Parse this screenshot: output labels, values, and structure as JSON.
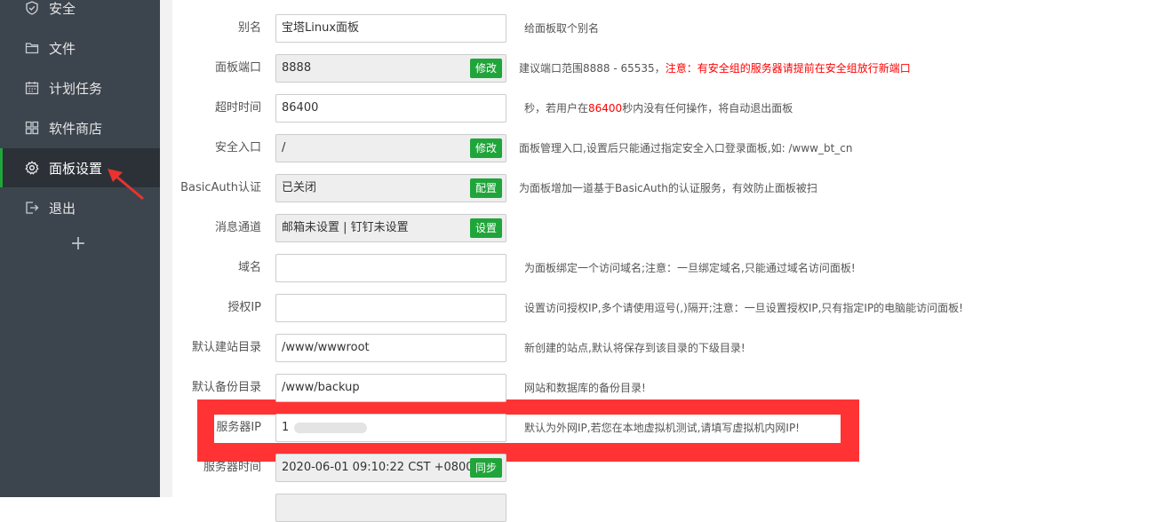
{
  "sidebar": {
    "items": [
      {
        "label": "安全",
        "icon": "shield-icon"
      },
      {
        "label": "文件",
        "icon": "folder-icon"
      },
      {
        "label": "计划任务",
        "icon": "calendar-icon"
      },
      {
        "label": "软件商店",
        "icon": "grid-icon"
      },
      {
        "label": "面板设置",
        "icon": "gear-icon",
        "active": true
      },
      {
        "label": "退出",
        "icon": "logout-icon"
      }
    ],
    "add_label": "+"
  },
  "form": {
    "alias": {
      "label": "别名",
      "value": "宝塔Linux面板",
      "hint": "给面板取个别名"
    },
    "port": {
      "label": "面板端口",
      "value": "8888",
      "button": "修改",
      "hint": "建议端口范围8888 - 65535，",
      "hint_warning": "注意：有安全组的服务器请提前在安全组放行新端口"
    },
    "timeout": {
      "label": "超时时间",
      "value": "86400",
      "hint_prefix": "秒，若用户在",
      "hint_value": "86400",
      "hint_suffix": "秒内没有任何操作，将自动退出面板"
    },
    "security_entry": {
      "label": "安全入口",
      "value": "/",
      "button": "修改",
      "hint": "面板管理入口,设置后只能通过指定安全入口登录面板,如: /www_bt_cn"
    },
    "basic_auth": {
      "label": "BasicAuth认证",
      "value": "已关闭",
      "button": "配置",
      "hint": "为面板增加一道基于BasicAuth的认证服务，有效防止面板被扫"
    },
    "message_channel": {
      "label": "消息通道",
      "value": "邮箱未设置 | 钉钉未设置",
      "button": "设置"
    },
    "domain": {
      "label": "域名",
      "value": "",
      "hint": "为面板绑定一个访问域名;注意：一旦绑定域名,只能通过域名访问面板!"
    },
    "auth_ip": {
      "label": "授权IP",
      "value": "",
      "hint": "设置访问授权IP,多个请使用逗号(,)隔开;注意：一旦设置授权IP,只有指定IP的电脑能访问面板!"
    },
    "site_dir": {
      "label": "默认建站目录",
      "value": "/www/wwwroot",
      "hint": "新创建的站点,默认将保存到该目录的下级目录!"
    },
    "backup_dir": {
      "label": "默认备份目录",
      "value": "/www/backup",
      "hint": "网站和数据库的备份目录!"
    },
    "server_ip": {
      "label": "服务器IP",
      "value": "1",
      "hint": "默认为外网IP,若您在本地虚拟机测试,请填写虚拟机内网IP!"
    },
    "server_time": {
      "label": "服务器时间",
      "value": "2020-06-01 09:10:22 CST +0800",
      "button": "同步"
    }
  },
  "colors": {
    "sidebar_bg": "#3c444d",
    "sidebar_active_bg": "#2c3138",
    "accent_green": "#20a53a",
    "warning_red": "#ff0000",
    "highlight_red": "#ff3333"
  }
}
